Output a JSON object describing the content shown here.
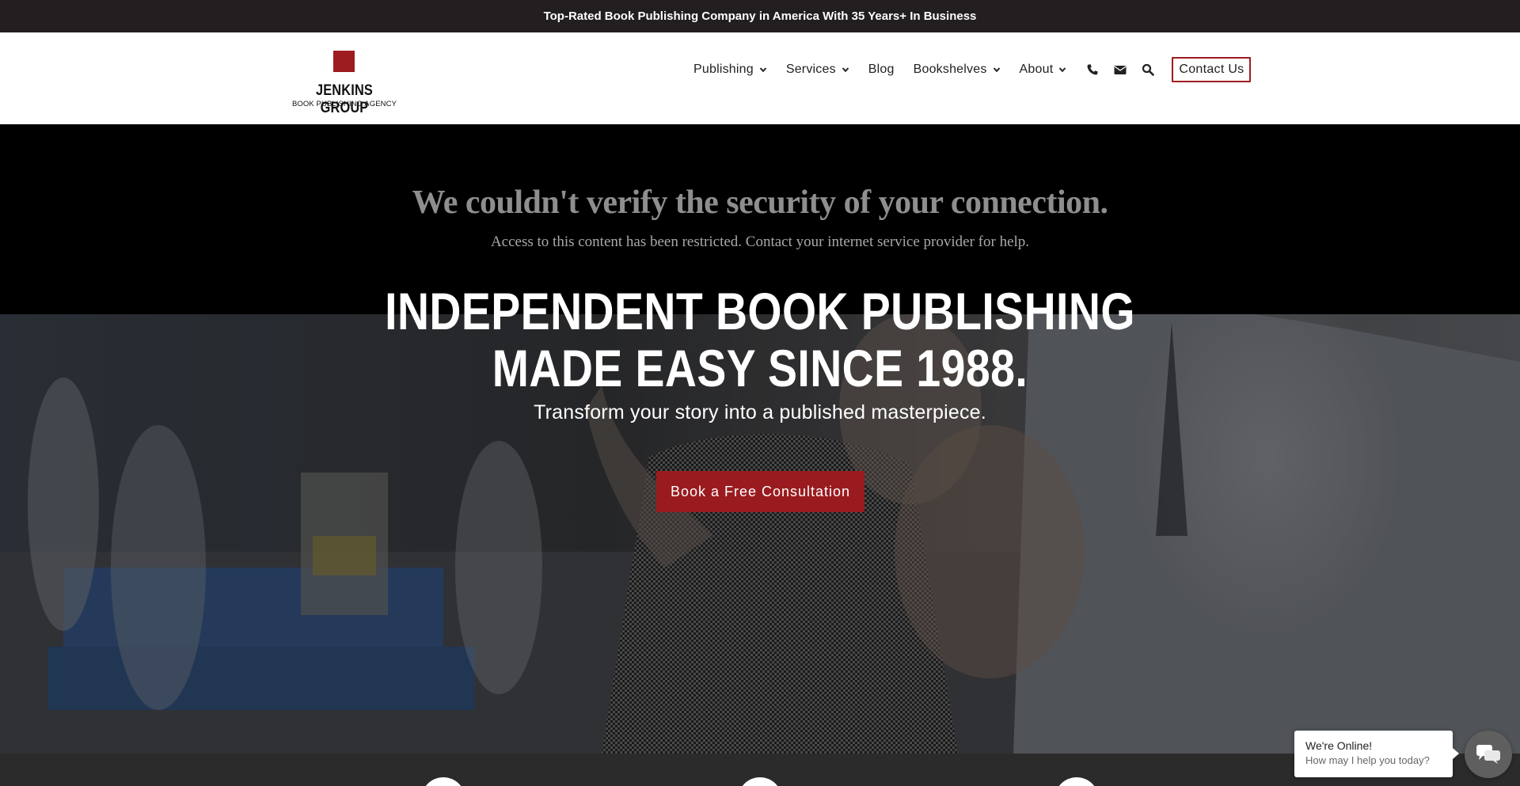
{
  "topbar": {
    "text": "Top-Rated Book Publishing Company in America With 35 Years+ In Business"
  },
  "logo": {
    "name": "JENKINS GROUP",
    "tagline": "BOOK PUBLISHING AGENCY"
  },
  "nav": {
    "items": [
      {
        "label": "Publishing",
        "has_dropdown": true
      },
      {
        "label": "Services",
        "has_dropdown": true
      },
      {
        "label": "Blog",
        "has_dropdown": false
      },
      {
        "label": "Bookshelves",
        "has_dropdown": true
      },
      {
        "label": "About",
        "has_dropdown": true
      }
    ],
    "icons": [
      "phone-icon",
      "envelope-icon",
      "search-icon"
    ],
    "contact_label": "Contact Us"
  },
  "notice": {
    "title": "We couldn't verify the security of your connection.",
    "subtitle": "Access to this content has been restricted. Contact your internet service provider for help."
  },
  "hero": {
    "headline_line1": "INDEPENDENT BOOK PUBLISHING",
    "headline_line2": "MADE EASY SINCE 1988.",
    "tagline": "Transform your story into a published masterpiece.",
    "cta_label": "Book a Free Consultation"
  },
  "chat": {
    "status": "We're Online!",
    "prompt": "How may I help you today?"
  },
  "colors": {
    "brand_red": "#9d1c20",
    "topbar_bg": "#231f20",
    "cta_bg": "#9a1b1f"
  }
}
